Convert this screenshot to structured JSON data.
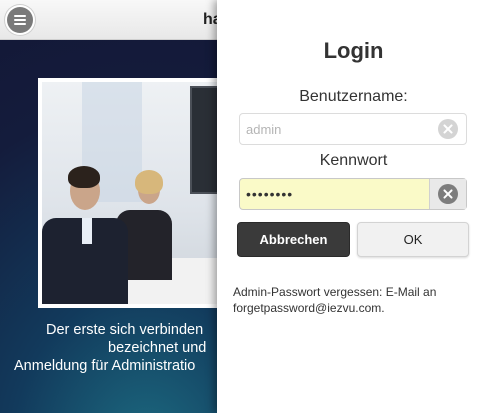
{
  "header": {
    "title": "ha",
    "menu_icon": "hamburger-menu-icon"
  },
  "welcome": {
    "line1": "Der erste sich verbinden",
    "line2": "bezeichnet und",
    "line3": "Anmeldung für Administratio"
  },
  "photo": {
    "description_icon": "meeting-photo"
  },
  "login": {
    "title": "Login",
    "username_label": "Benutzername:",
    "username_placeholder": "admin",
    "username_value": "",
    "password_label": "Kennwort",
    "password_value": "••••••••",
    "cancel_label": "Abbrechen",
    "ok_label": "OK",
    "forgot_text": "Admin-Passwort vergessen: E-Mail an forgetpassword@iezvu.com.",
    "clear_icon": "clear-icon"
  },
  "colors": {
    "header_bg": "#efefef",
    "content_bg": "#141c3c",
    "cancel_bg": "#3a3a3a",
    "password_autofill_bg": "#fafac8"
  }
}
